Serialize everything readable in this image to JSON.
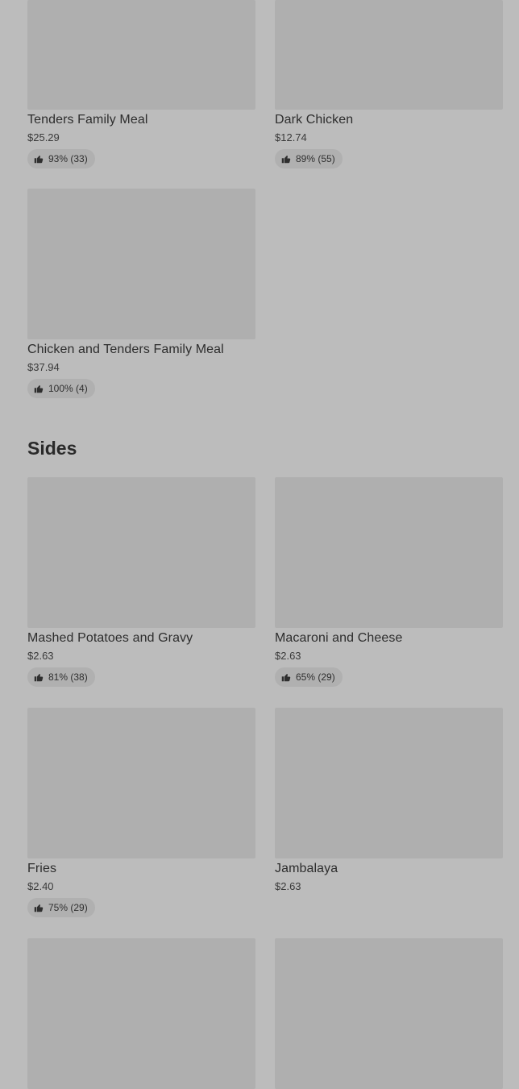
{
  "combos": [
    {
      "name": "Tenders Family Meal",
      "price": "$25.29",
      "rating": "93% (33)"
    },
    {
      "name": "Dark Chicken",
      "price": "$12.74",
      "rating": "89% (55)"
    },
    {
      "name": "Chicken and Tenders Family Meal",
      "price": "$37.94",
      "rating": "100% (4)"
    }
  ],
  "sides_section": {
    "title": "Sides",
    "items": [
      {
        "name": "Mashed Potatoes and Gravy",
        "price": "$2.63",
        "rating": "81% (38)"
      },
      {
        "name": "Macaroni and Cheese",
        "price": "$2.63",
        "rating": "65% (29)"
      },
      {
        "name": "Fries",
        "price": "$2.40",
        "rating": "75% (29)"
      },
      {
        "name": "Jambalaya",
        "price": "$2.63"
      }
    ]
  },
  "icons": {
    "rating": "thumbs-up-icon"
  },
  "colors": {
    "background": "#bcbcbc",
    "thumbnail": "#afafaf",
    "rating_pill": "#b0b0b0",
    "text": "#2a2a2a"
  }
}
